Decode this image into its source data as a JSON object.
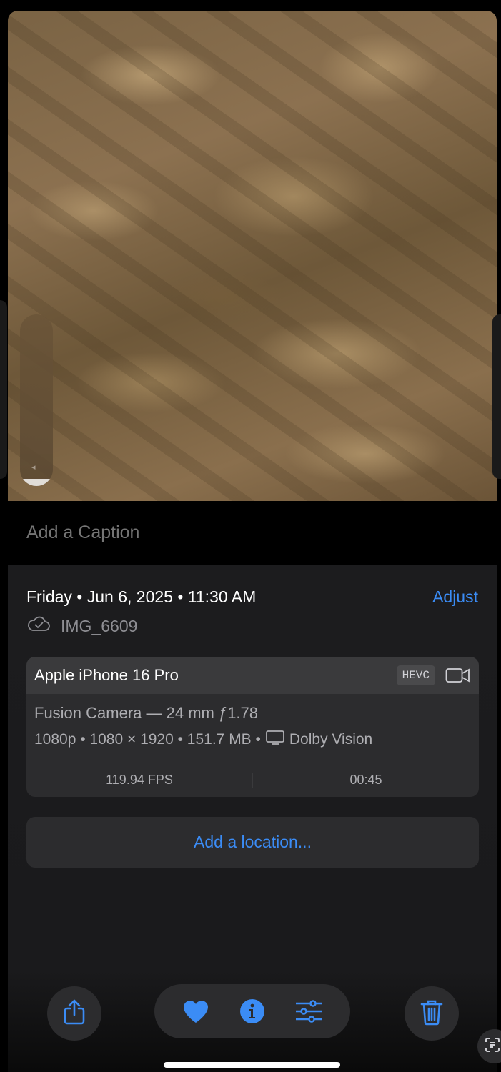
{
  "caption": {
    "placeholder": "Add a Caption"
  },
  "info": {
    "datetime": "Friday • Jun 6, 2025 • 11:30 AM",
    "adjust_label": "Adjust",
    "filename": "IMG_6609"
  },
  "device": {
    "name": "Apple iPhone 16 Pro",
    "format": "HEVC",
    "lens": "Fusion Camera — 24 mm ƒ1.78",
    "specs": "1080p • 1080 × 1920 • 151.7 MB •",
    "hdr": "Dolby Vision",
    "fps": "119.94 FPS",
    "duration": "00:45"
  },
  "location": {
    "label": "Add a location..."
  },
  "colors": {
    "accent": "#3b8cf5",
    "panel": "#1c1c1e",
    "card": "#2c2c2e"
  },
  "toolbar": {
    "icons": [
      "share-icon",
      "heart-icon",
      "info-icon",
      "adjustments-icon",
      "trash-icon",
      "live-text-icon"
    ]
  }
}
